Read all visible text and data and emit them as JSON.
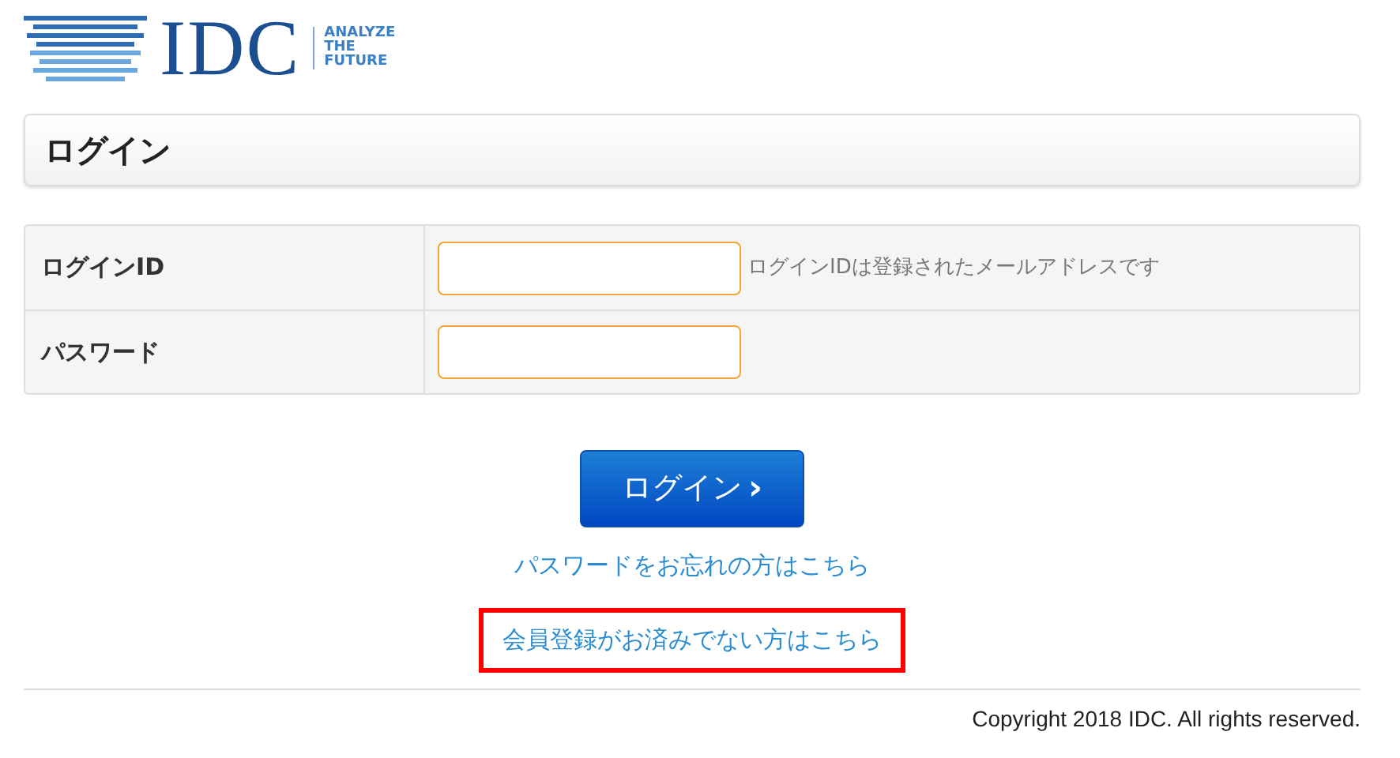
{
  "logo": {
    "name": "IDC",
    "tagline": [
      "ANALYZE",
      "THE",
      "FUTURE"
    ]
  },
  "panel": {
    "title": "ログイン"
  },
  "form": {
    "rows": [
      {
        "label": "ログインID",
        "hint": "ログインIDは登録されたメールアドレスです"
      },
      {
        "label": "パスワード"
      }
    ]
  },
  "login_button": {
    "label": "ログイン",
    "chevron": "›"
  },
  "links": [
    {
      "text": "パスワードをお忘れの方はこちら",
      "highlighted": false
    },
    {
      "text": "会員登録がお済みでない方はこちら",
      "highlighted": true
    }
  ],
  "footer": {
    "copyright": "Copyright 2018 IDC. All rights reserved."
  }
}
